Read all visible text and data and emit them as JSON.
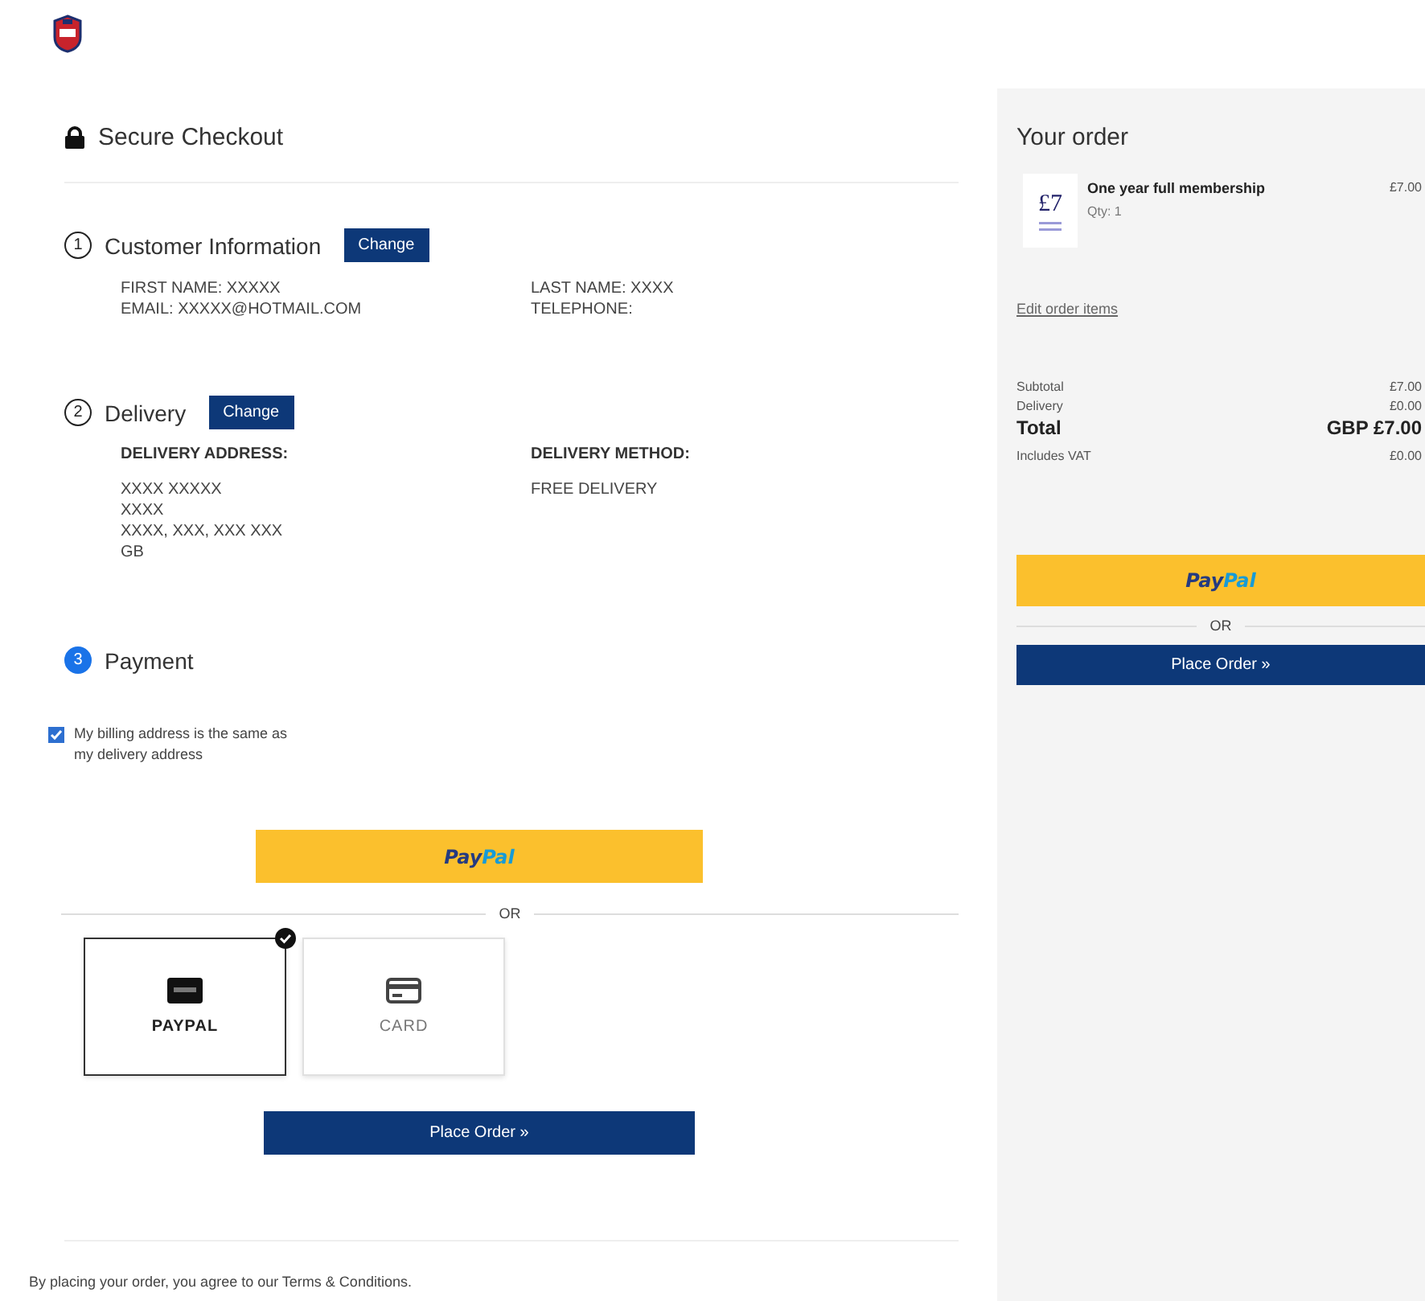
{
  "header": {
    "title": "Secure Checkout"
  },
  "steps": [
    {
      "number": "1",
      "title": "Customer Information",
      "active": false,
      "change_button": "Change",
      "columns": [
        {
          "lines": [
            "FIRST NAME: XXXXX",
            "EMAIL: XXXXX@HOTMAIL.COM"
          ]
        },
        {
          "lines": [
            "LAST NAME: XXXX",
            "TELEPHONE:"
          ]
        }
      ]
    },
    {
      "number": "2",
      "title": "Delivery",
      "active": false,
      "change_button": "Change",
      "columns": [
        {
          "heading": "DELIVERY ADDRESS:",
          "lines": [
            "XXXX XXXXX",
            "XXXX",
            "XXXX, XXX, XXX XXX",
            "GB"
          ]
        },
        {
          "heading": "DELIVERY METHOD:",
          "lines": [
            "FREE DELIVERY"
          ]
        }
      ]
    },
    {
      "number": "3",
      "title": "Payment",
      "active": true
    }
  ],
  "billing_same": {
    "label": "My billing address is the same as my delivery address",
    "checked": true
  },
  "paypal_button": {
    "pay": "Pay",
    "pal": "Pal"
  },
  "divider_text": "OR",
  "payment_methods": [
    {
      "kind": "paypal",
      "label": "PAYPAL",
      "selected": true
    },
    {
      "kind": "card",
      "label": "CARD",
      "selected": false
    }
  ],
  "place_order": "Place Order »",
  "terms": "By placing your order, you agree to our Terms & Conditions.",
  "order": {
    "title": "Your order",
    "items": [
      {
        "thumb_text": "£7",
        "name": "One year full membership",
        "qty": "Qty: 1",
        "price": "£7.00"
      }
    ],
    "edit_link": "Edit order items",
    "totals": [
      {
        "kind": "line",
        "label": "Subtotal",
        "value": "£7.00"
      },
      {
        "kind": "line",
        "label": "Delivery",
        "value": "£0.00"
      },
      {
        "kind": "total",
        "label": "Total",
        "value": "GBP £7.00"
      },
      {
        "kind": "vat",
        "label": "Includes VAT",
        "value": "£0.00"
      }
    ],
    "paypal_button": {
      "pay": "Pay",
      "pal": "Pal"
    },
    "divider_text": "OR",
    "place_order": "Place Order »"
  }
}
